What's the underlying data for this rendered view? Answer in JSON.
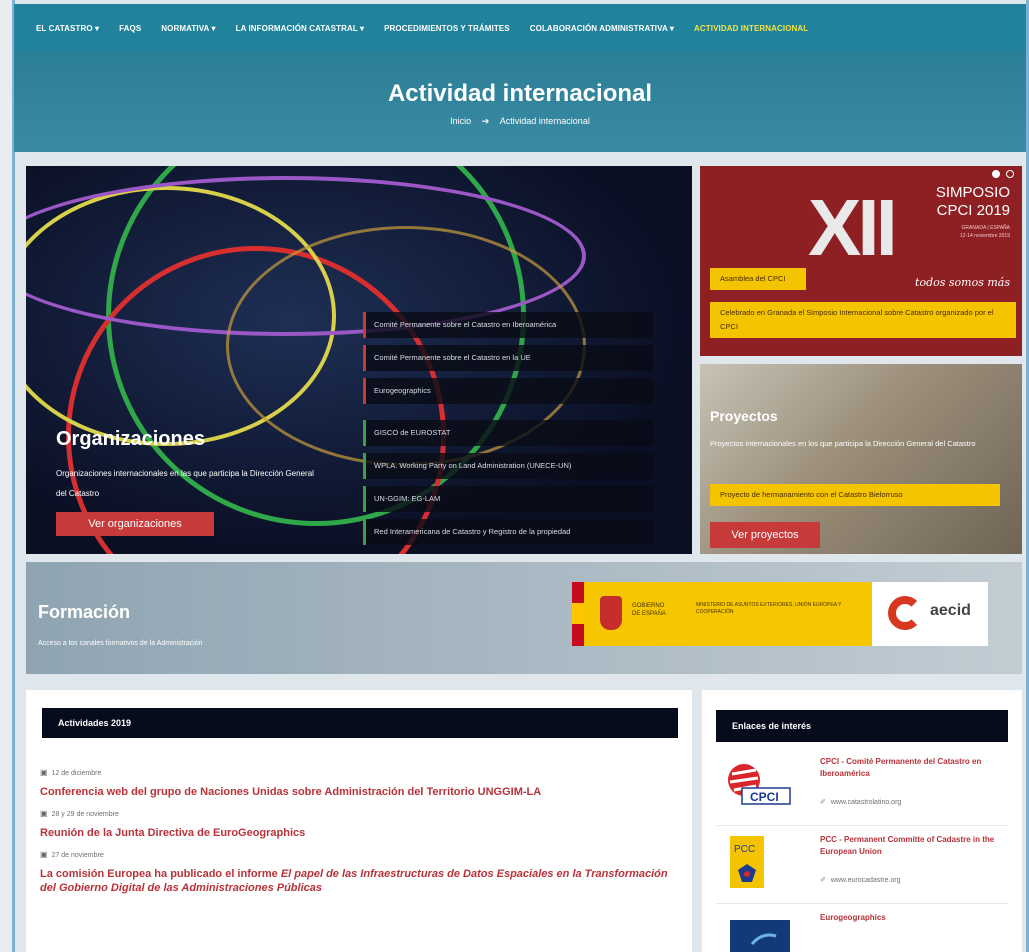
{
  "nav": {
    "items": [
      {
        "label": "EL CATASTRO ▾"
      },
      {
        "label": "FAQS"
      },
      {
        "label": "NORMATIVA ▾"
      },
      {
        "label": "LA INFORMACIÓN CATASTRAL ▾"
      },
      {
        "label": "PROCEDIMIENTOS Y TRÁMITES"
      },
      {
        "label": "COLABORACIÓN ADMINISTRATIVA ▾"
      },
      {
        "label": "ACTIVIDAD INTERNACIONAL"
      }
    ]
  },
  "hero": {
    "title": "Actividad internacional",
    "breadcrumb_home": "Inicio",
    "breadcrumb_arrow": "➔",
    "breadcrumb_current": "Actividad internacional"
  },
  "organizaciones": {
    "title": "Organizaciones",
    "description": "Organizaciones internacionales en las que participa la Dirección General del Catastro",
    "button": "Ver organizaciones",
    "items": [
      "Comité Permanente sobre el Catastro en Iberoamérica",
      "Comité Permanente sobre el Catastro en la UE",
      "Eurogeographics",
      "GISCO de EUROSTAT",
      "WPLA. Working Party on Land Administration (UNECE-UN)",
      "UN-GGIM: EG-LAM",
      "Red Interamericana de Catastro y Registro de la propiedad"
    ]
  },
  "simposio": {
    "numeral": "XII",
    "name_line1": "SIMPOSIO",
    "name_line2": "CPCI 2019",
    "sub_line1": "GRANADA | ESPAÑA",
    "sub_line2": "12-14 noviembre 2019",
    "motto": "todos somos más",
    "asamblea": "Asamblea del CPCI",
    "celebrado": "Celebrado en Granada el Simposio Internacional sobre Catastro organizado por el CPCI"
  },
  "proyectos": {
    "title": "Proyectos",
    "description": "Proyectos internacionales en los que participa la Dirección General del Catastro",
    "box": "Proyecto de hermanamiento con el Catastro Bielorruso",
    "button": "Ver proyectos"
  },
  "formacion": {
    "title": "Formación",
    "description": "Acceso a los canales formativos de la Administración",
    "gov_line1": "GOBIERNO",
    "gov_line2": "DE ESPAÑA",
    "ministry": "MINISTERIO DE ASUNTOS EXTERIORES, UNIÓN EUROPEA Y COOPERACIÓN",
    "aecid": "aecid"
  },
  "actividades": {
    "heading": "Actividades 2019",
    "items": [
      {
        "date": "12 de diciembre",
        "title": "Conferencia web del grupo de Naciones Unidas sobre Administración del Territorio UNGGIM-LA"
      },
      {
        "date": "28 y 29 de noviembre",
        "title": "Reunión de la Junta Directiva de EuroGeographics"
      },
      {
        "date": "27 de noviembre",
        "title_prefix": "La comisión Europea ha publicado el informe ",
        "title_italic": "El papel de las Infraestructuras de Datos Espaciales en la Transformación del Gobierno Digital de las Administraciones Públicas"
      }
    ]
  },
  "enlaces": {
    "heading": "Enlaces de interés",
    "items": [
      {
        "name": "CPCI - Comité Permanente del Catastro en Iberoamérica",
        "url": "www.catastrolatino.org",
        "logo": "CPCI"
      },
      {
        "name": "PCC - Permanent Committe of Cadastre in the European Union",
        "url": "www.eurocadastre.org",
        "logo": "PCC"
      },
      {
        "name": "Eurogeographics",
        "url": "",
        "logo": ""
      }
    ]
  },
  "colors": {
    "nav": "#21829b",
    "accent_red": "#c63a3a",
    "accent_yellow": "#f5c400",
    "active_nav": "#f2e14a",
    "dark_header": "#070c1c"
  }
}
